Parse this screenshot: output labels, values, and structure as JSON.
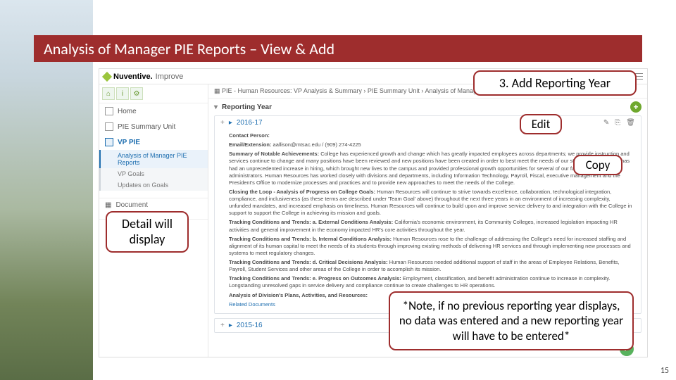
{
  "slide": {
    "title": "Analysis of Manager PIE Reports – View & Add",
    "page_number": "15"
  },
  "callouts": {
    "reporting": "3. Add Reporting Year",
    "edit": "Edit",
    "copy": "Copy",
    "detail": "Detail will display",
    "note": "*Note, if no previous reporting year displays, no data was entered and a new reporting year will have to be entered*"
  },
  "app": {
    "brand": {
      "name": "Nuventive.",
      "product": "Improve"
    },
    "top_dropdown": "PIE - Human Resources: VP Analysis & Summary",
    "breadcrumb": "PIE - Human Resources: VP Analysis & Summary  ›  PIE Summary Unit  ›  Analysis of Manager PIE Reports",
    "rail": {
      "items": {
        "home": "Home",
        "pie_summary_unit": "PIE Summary Unit",
        "vp_pie": "VP PIE",
        "subs": {
          "analysis": "Analysis of Manager PIE Reports",
          "vp_goals": "VP Goals",
          "updates": "Updates on Goals"
        },
        "document": "Document"
      }
    },
    "section_header": "Reporting Year",
    "cards": {
      "y2016": {
        "title": "2016-17",
        "contact_label": "Contact Person:",
        "email_label": "Email/Extension:",
        "email_value": "aallison@mtsac.edu / (909) 274-4225",
        "summary_label": "Summary of Notable Achievements:",
        "summary": "College has experienced growth and change which has greatly impacted employees across departments; we provide instruction and services continue to change and many positions have been reviewed and new positions have been created in order to best meet the needs of our students; the College has had an unprecedented increase in hiring, which brought new lives to the campus and provided professional growth opportunities for several of our faculty, staff and administrators. Human Resources has worked closely with divisions and departments, including Information Technology, Payroll, Fiscal, executive management and the President's Office to modernize processes and practices and to provide new approaches to meet the needs of the College.",
        "closing_label": "Closing the Loop - Analysis of Progress on College Goals:",
        "closing": "Human Resources will continue to strive towards excellence, collaboration, technological integration, compliance, and inclusiveness (as these terms are described under 'Team Goal' above) throughout the next three years in an environment of increasing complexity, unfunded mandates, and increased emphasis on timeliness. Human Resources will continue to build upon and improve service delivery to and integration with the College in support to support the College in achieving its mission and goals.",
        "t1_label": "Tracking Conditions and Trends: a. External Conditions Analysis:",
        "t1": "California's economic environment, its Community Colleges, increased legislation impacting HR activities and general improvement in the economy impacted HR's core activities throughout the year.",
        "t2_label": "Tracking Conditions and Trends: b. Internal Conditions Analysis:",
        "t2": "Human Resources rose to the challenge of addressing the College's need for increased staffing and alignment of its human capital to meet the needs of its students through improving existing methods of delivering HR services and through implementing new processes and systems to meet regulatory changes.",
        "t3_label": "Tracking Conditions and Trends: d. Critical Decisions Analysis:",
        "t3": "Human Resources needed additional support of staff in the areas of Employee Relations, Benefits, Payroll, Student Services and other areas of the College in order to accomplish its mission.",
        "t4_label": "Tracking Conditions and Trends: e. Progress on Outcomes Analysis:",
        "t4": "Employment, classification, and benefit administration continue to increase in complexity. Longstanding unresolved gaps in service delivery and compliance continue to create challenges to HR operations.",
        "extra_label": "Analysis of Division's Plans, Activities, and Resources:",
        "related": "Related Documents"
      },
      "y2015": {
        "title": "2015-16"
      }
    }
  }
}
